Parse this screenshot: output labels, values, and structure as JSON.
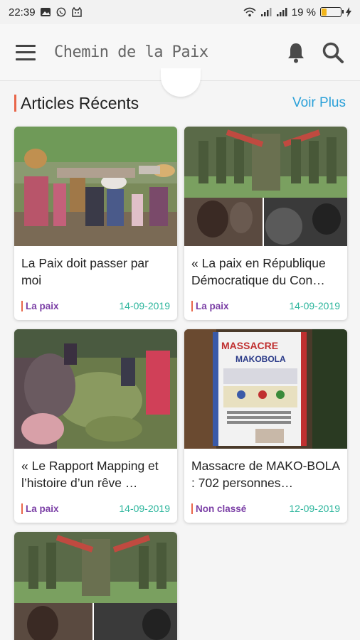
{
  "status_bar": {
    "time": "22:39",
    "battery": "19 %",
    "left_icons": [
      "gallery-icon",
      "whatsapp-icon",
      "cat-icon"
    ],
    "right_icons": [
      "wifi-icon",
      "signal-icon",
      "signal-icon",
      "battery-icon"
    ]
  },
  "app_bar": {
    "title": "Chemin de la Paix",
    "menu_icon": "menu-icon",
    "actions": [
      "bell-icon",
      "search-icon"
    ]
  },
  "section": {
    "title": "Articles Récents",
    "see_more": "Voir Plus",
    "accent_color": "#e8664a",
    "link_color": "#2aa0d8"
  },
  "articles": [
    {
      "title": "La Paix doit passer par moi",
      "category": "La paix",
      "date": "14-09-2019"
    },
    {
      "title": "« La paix en République Démocratique du Con…",
      "category": "La paix",
      "date": "14-09-2019"
    },
    {
      "title": "« Le Rapport Mapping et l’histoire d’un rêve …",
      "category": "La paix",
      "date": "14-09-2019"
    },
    {
      "title": "Massacre de MAKO-BOLA : 702 personnes…",
      "category": "Non classé",
      "date": "12-09-2019"
    },
    {
      "title": "",
      "category": "",
      "date": ""
    }
  ],
  "colors": {
    "category": "#7b3fa6",
    "date": "#2bb59c"
  }
}
